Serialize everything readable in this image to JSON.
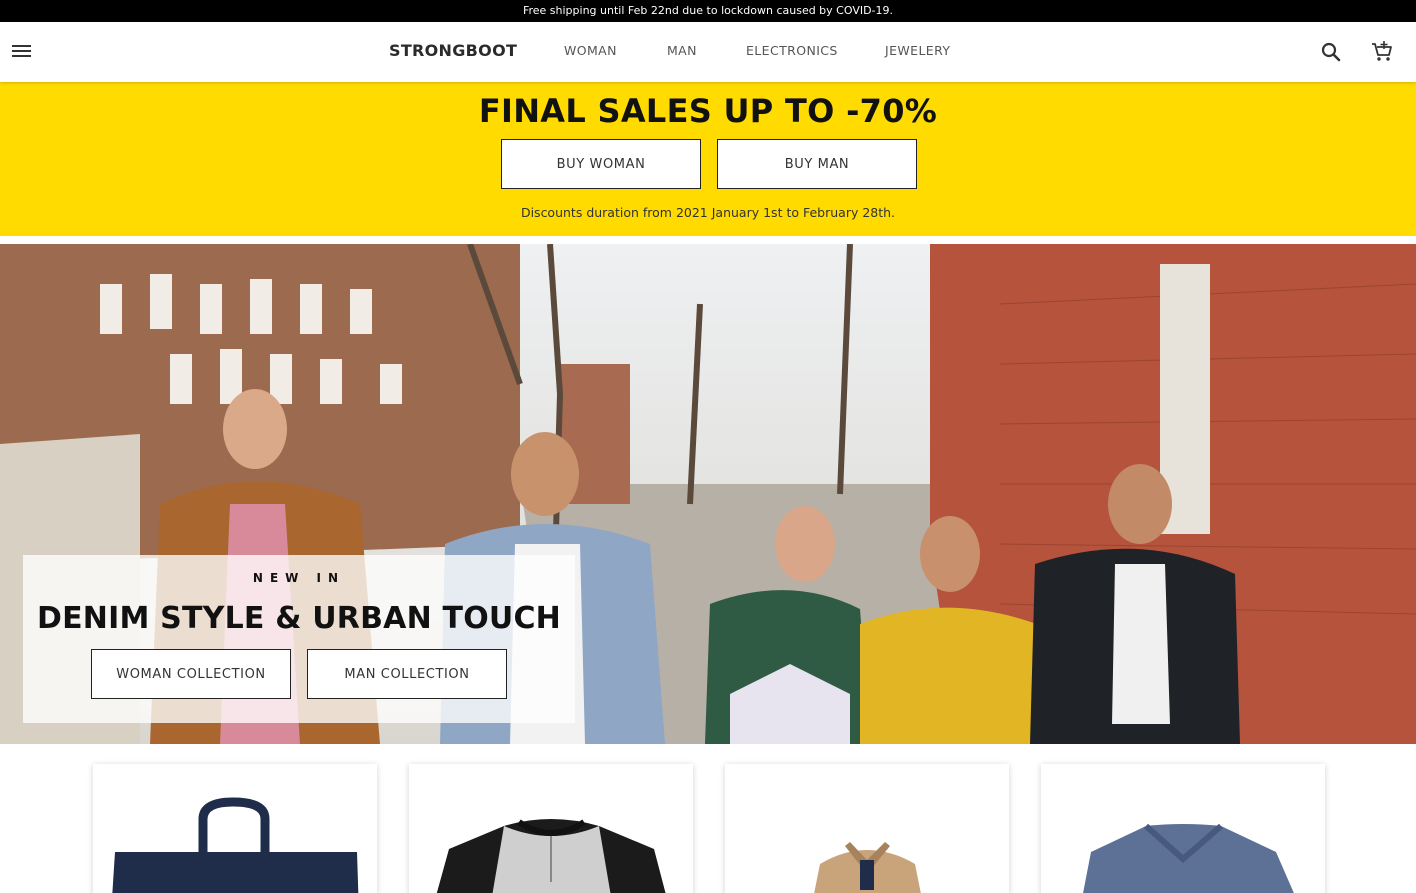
{
  "announcement": "Free shipping until Feb 22nd due to lockdown caused by COVID-19.",
  "navbar": {
    "brand": "STRONGBOOT",
    "links": [
      "WOMAN",
      "MAN",
      "ELECTRONICS",
      "JEWELERY"
    ],
    "icons": [
      "menu-icon",
      "search-icon",
      "cart-icon"
    ]
  },
  "sale": {
    "title": "FINAL SALES UP TO -70%",
    "buttons": [
      "BUY WOMAN",
      "BUY MAN"
    ],
    "note": "Discounts duration from 2021 January 1st to February 28th."
  },
  "hero": {
    "kicker": "NEW IN",
    "title": "DENIM STYLE & URBAN TOUCH",
    "buttons": [
      "WOMAN COLLECTION",
      "MAN COLLECTION"
    ]
  },
  "colors": {
    "announcement_bg": "#000000",
    "sale_bg": "#ffdb00",
    "text": "#111111"
  }
}
